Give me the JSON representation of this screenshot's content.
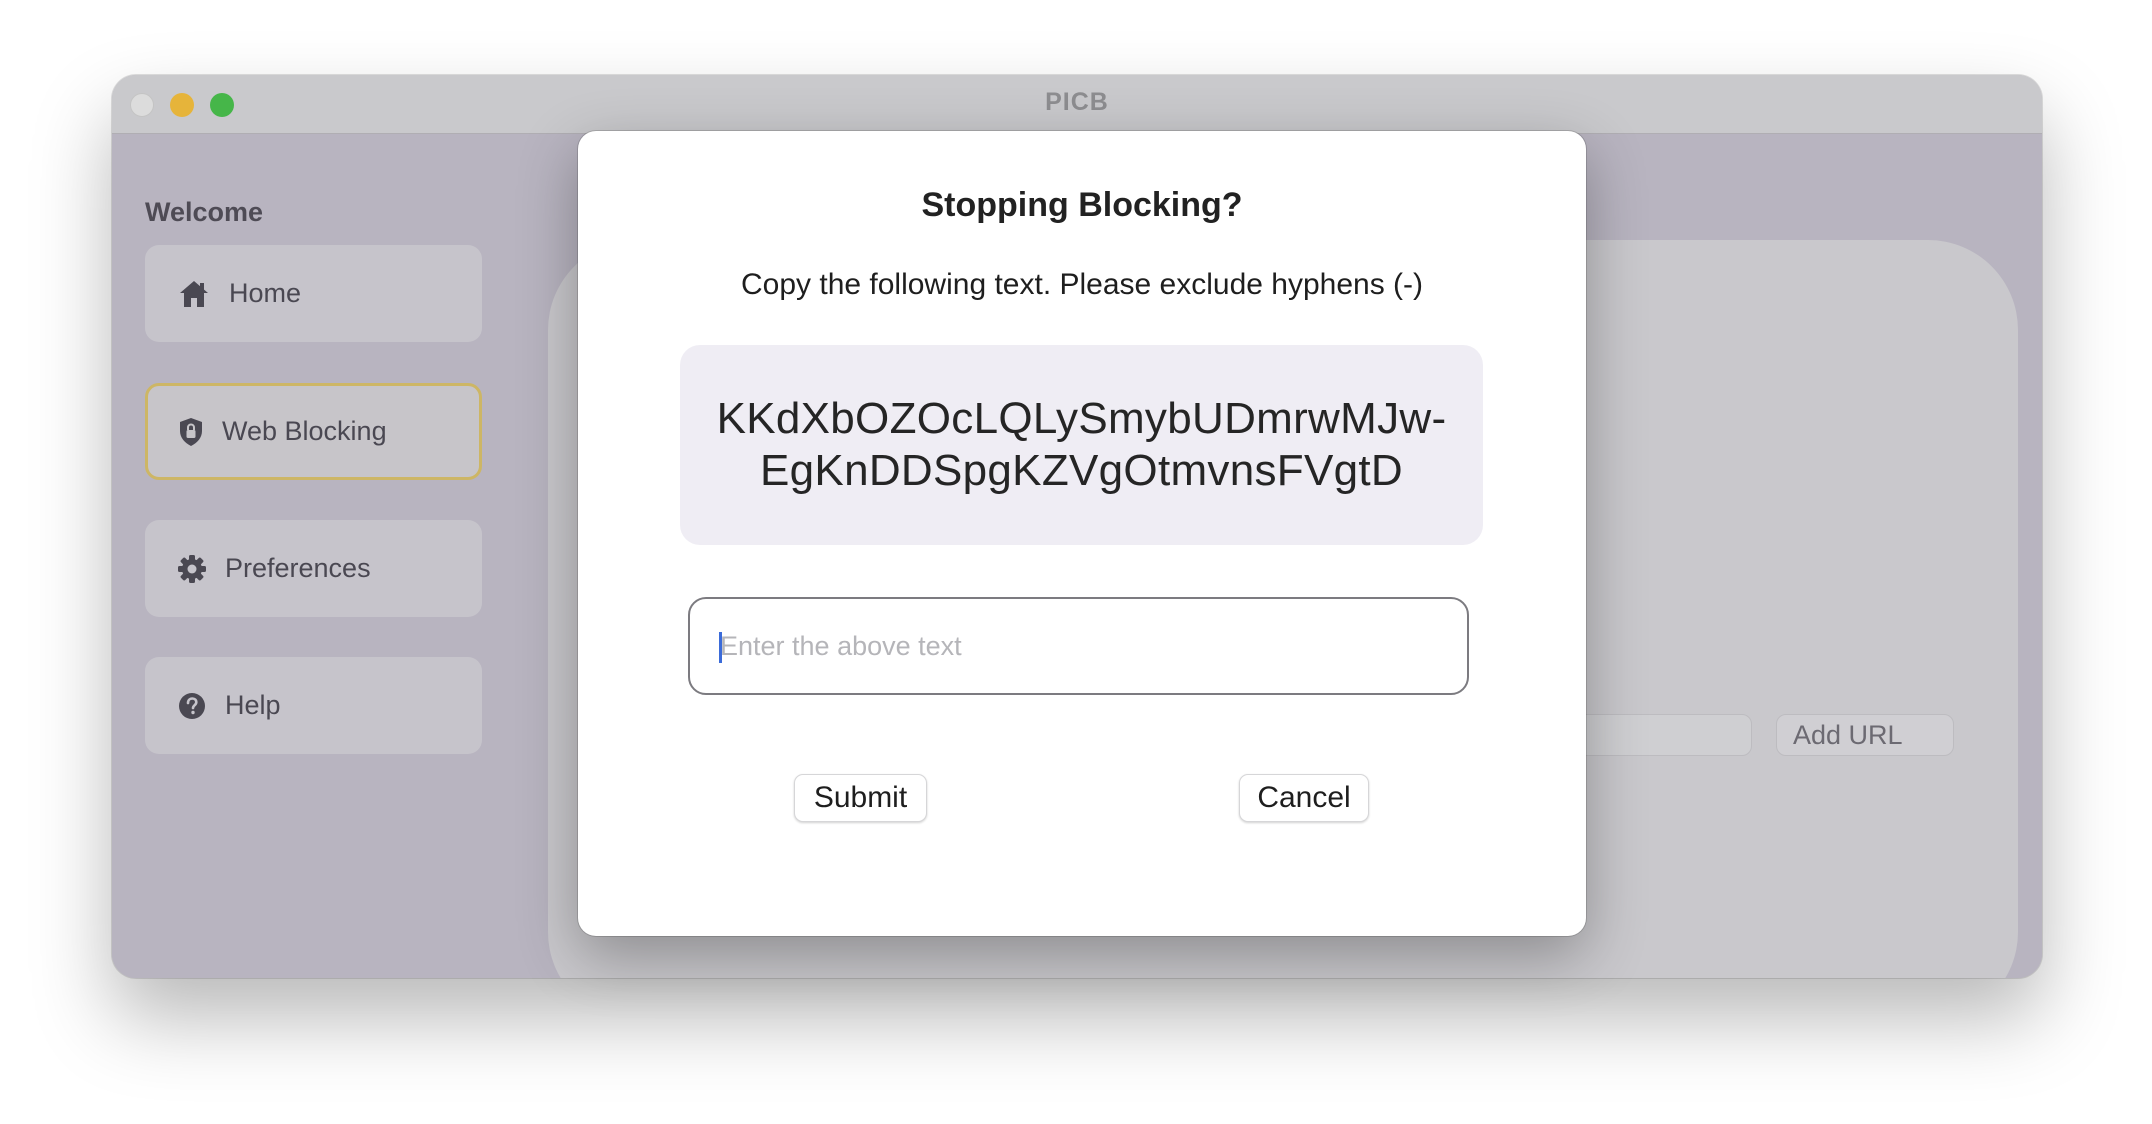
{
  "window": {
    "title": "PICB"
  },
  "sidebar": {
    "title": "Welcome",
    "items": [
      {
        "label": "Home",
        "icon": "home-icon",
        "active": false
      },
      {
        "label": "Web Blocking",
        "icon": "shield-lock-icon",
        "active": true
      },
      {
        "label": "Preferences",
        "icon": "gear-icon",
        "active": false
      },
      {
        "label": "Help",
        "icon": "question-circle-icon",
        "active": false
      }
    ]
  },
  "main": {
    "add_url_label": "Add URL"
  },
  "dialog": {
    "title": "Stopping Blocking?",
    "instruction": "Copy the following text. Please exclude hyphens (-)",
    "code_line1": "KKdXbOZOcLQLySmybUDmrwMJw-",
    "code_line2": "EgKnDDSpgKZVgOtmvnsFVgtD",
    "input_placeholder": "Enter the above text",
    "input_value": "",
    "submit_label": "Submit",
    "cancel_label": "Cancel"
  },
  "colors": {
    "accent_border": "#cdb665",
    "caret": "#3b6bd9",
    "traffic_min": "#e6b43a",
    "traffic_max": "#46b649"
  }
}
